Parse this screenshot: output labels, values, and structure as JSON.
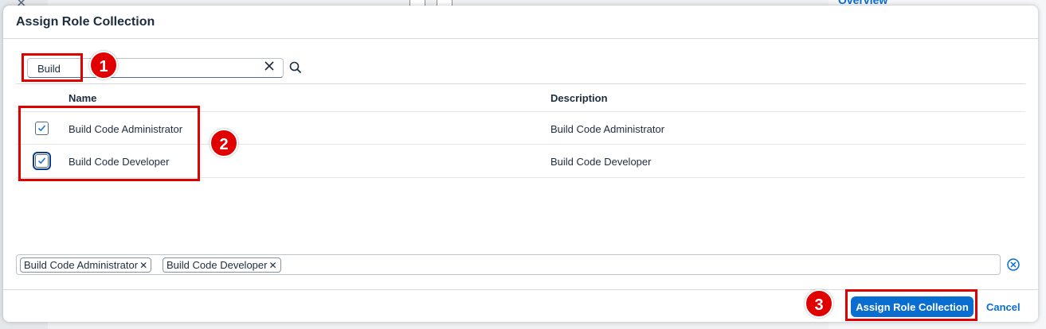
{
  "dialog": {
    "title": "Assign Role Collection"
  },
  "background": {
    "overview_label": "Overview"
  },
  "search": {
    "value": "Build",
    "clear_icon": "close-icon",
    "search_icon": "search-icon"
  },
  "table": {
    "columns": [
      "Name",
      "Description"
    ],
    "rows": [
      {
        "name": "Build Code Administrator",
        "description": "Build Code Administrator",
        "checked": true
      },
      {
        "name": "Build Code Developer",
        "description": "Build Code Developer",
        "checked": true
      }
    ]
  },
  "selected_tokens": [
    "Build Code Administrator",
    "Build Code Developer"
  ],
  "footer": {
    "assign_label": "Assign Role Collection",
    "cancel_label": "Cancel"
  },
  "annotations": {
    "step1": "1",
    "step2": "2",
    "step3": "3"
  },
  "colors": {
    "accent": "#0a6ed1",
    "annotation": "#e00000"
  }
}
